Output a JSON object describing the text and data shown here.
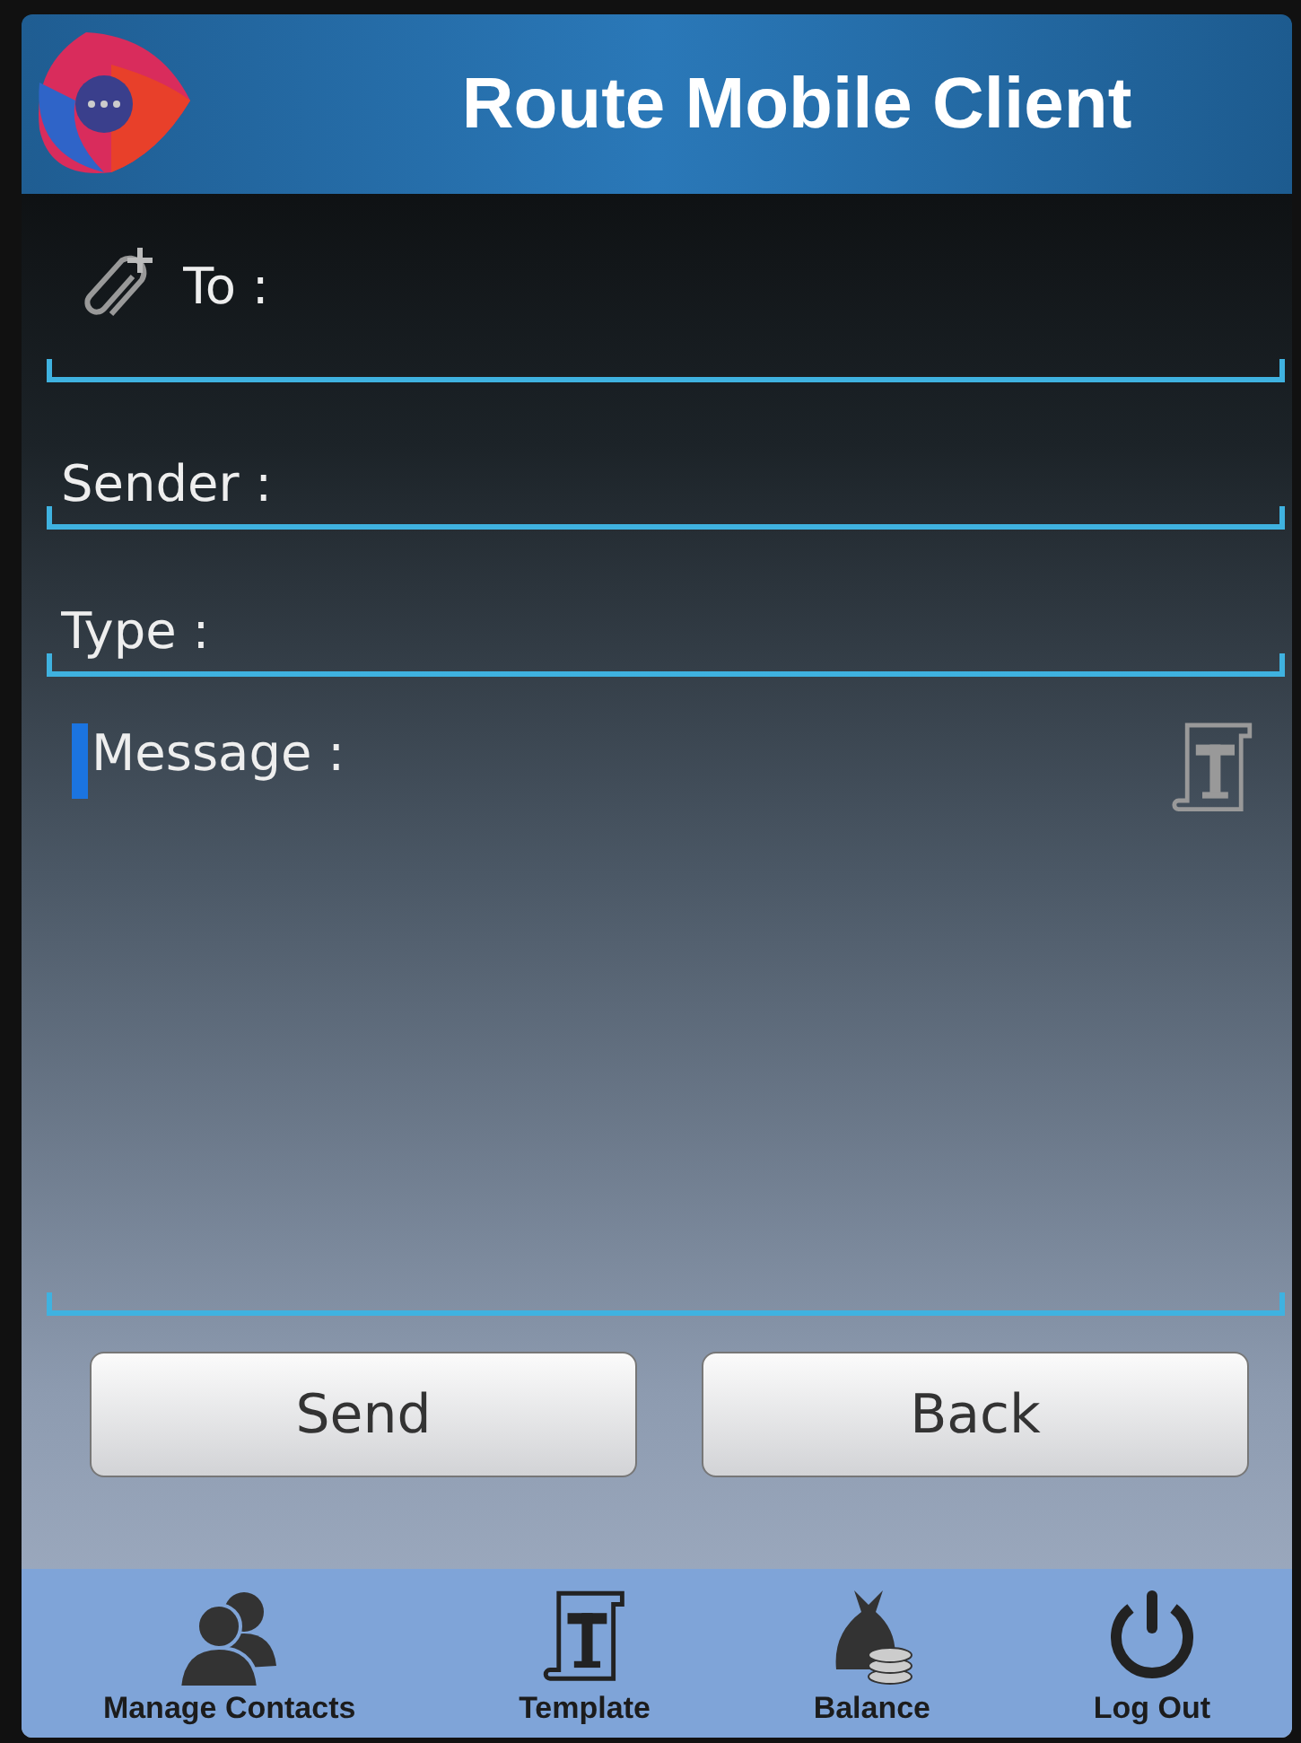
{
  "header": {
    "title": "Route Mobile Client"
  },
  "fields": [
    {
      "kind": "recipient",
      "placeholder": "To :",
      "focused": false
    },
    {
      "kind": "line",
      "placeholder": "Sender :",
      "focused": false
    },
    {
      "kind": "line",
      "placeholder": "Type :",
      "focused": false
    },
    {
      "kind": "message",
      "placeholder": "Message :",
      "focused": true
    }
  ],
  "buttons": [
    "Send",
    "Back"
  ],
  "nav": [
    {
      "kind": "contacts",
      "label": "Manage Contacts"
    },
    {
      "kind": "template",
      "label": "Template"
    },
    {
      "kind": "balance",
      "label": "Balance"
    },
    {
      "kind": "logout",
      "label": "Log Out"
    }
  ]
}
